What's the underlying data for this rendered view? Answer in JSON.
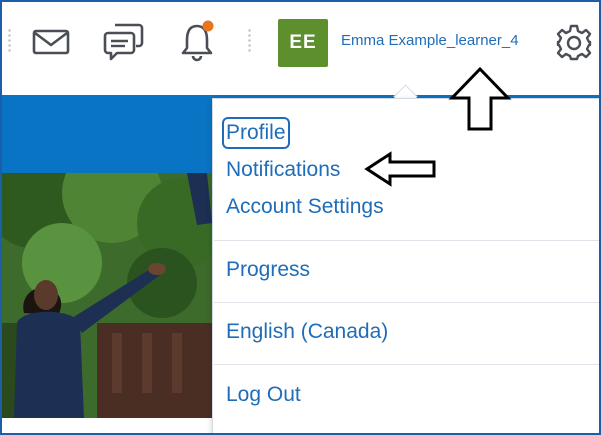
{
  "header": {
    "icons": {
      "mail": "mail-icon",
      "chat": "chat-icon",
      "notifications": "bell-icon",
      "settings": "gear-icon"
    },
    "notification_dot_color": "#e8761e",
    "avatar_initials": "EE",
    "avatar_color": "#5d8f2c",
    "username": "Emma Example_learner_4"
  },
  "banner": {
    "color": "#0a74c4"
  },
  "menu": {
    "items": [
      {
        "label": "Profile",
        "focused": true
      },
      {
        "label": "Notifications"
      },
      {
        "label": "Account Settings"
      },
      {
        "label": "Progress"
      },
      {
        "label": "English (Canada)"
      },
      {
        "label": "Log Out"
      }
    ],
    "accent": "#1f6db8"
  },
  "annotations": {
    "arrow_up": "arrow-up-annotation",
    "arrow_left": "arrow-left-annotation"
  }
}
